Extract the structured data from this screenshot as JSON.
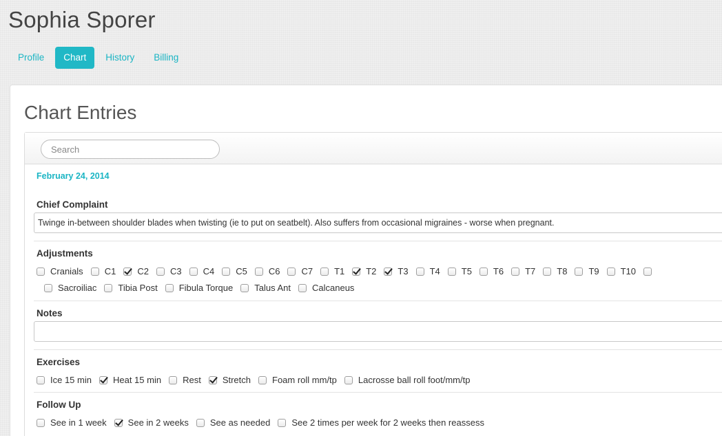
{
  "patient_name": "Sophia Sporer",
  "nav": [
    {
      "label": "Profile",
      "active": false
    },
    {
      "label": "Chart",
      "active": true
    },
    {
      "label": "History",
      "active": false
    },
    {
      "label": "Billing",
      "active": false
    }
  ],
  "panel": {
    "title": "Chart Entries",
    "search_placeholder": "Search"
  },
  "entry": {
    "date": "February 24, 2014",
    "chief_complaint": {
      "title": "Chief Complaint",
      "text": "Twinge in-between shoulder blades when twisting (ie to put on seatbelt). Also suffers from occasional migraines - worse when pregnant."
    },
    "adjustments": {
      "title": "Adjustments",
      "rows": [
        [
          {
            "label": "Cranials",
            "checked": false
          },
          {
            "label": "C1",
            "checked": false
          },
          {
            "label": "C2",
            "checked": true
          },
          {
            "label": "C3",
            "checked": false
          },
          {
            "label": "C4",
            "checked": false
          },
          {
            "label": "C5",
            "checked": false
          },
          {
            "label": "C6",
            "checked": false
          },
          {
            "label": "C7",
            "checked": false
          },
          {
            "label": "T1",
            "checked": false
          },
          {
            "label": "T2",
            "checked": true
          },
          {
            "label": "T3",
            "checked": true
          },
          {
            "label": "T4",
            "checked": false
          },
          {
            "label": "T5",
            "checked": false
          },
          {
            "label": "T6",
            "checked": false
          },
          {
            "label": "T7",
            "checked": false
          },
          {
            "label": "T8",
            "checked": false
          },
          {
            "label": "T9",
            "checked": false
          },
          {
            "label": "T10",
            "checked": false
          },
          {
            "label": "",
            "checked": false
          }
        ],
        [
          {
            "label": "Sacroiliac",
            "checked": false
          },
          {
            "label": "Tibia Post",
            "checked": false
          },
          {
            "label": "Fibula Torque",
            "checked": false
          },
          {
            "label": "Talus Ant",
            "checked": false
          },
          {
            "label": "Calcaneus",
            "checked": false
          }
        ]
      ]
    },
    "notes": {
      "title": "Notes",
      "value": ""
    },
    "exercises": {
      "title": "Exercises",
      "items": [
        {
          "label": "Ice 15 min",
          "checked": false
        },
        {
          "label": "Heat 15 min",
          "checked": true
        },
        {
          "label": "Rest",
          "checked": false
        },
        {
          "label": "Stretch",
          "checked": true
        },
        {
          "label": "Foam roll mm/tp",
          "checked": false
        },
        {
          "label": "Lacrosse ball roll foot/mm/tp",
          "checked": false
        }
      ]
    },
    "follow_up": {
      "title": "Follow Up",
      "items": [
        {
          "label": "See in 1 week",
          "checked": false
        },
        {
          "label": "See in 2 weeks",
          "checked": true
        },
        {
          "label": "See as needed",
          "checked": false
        },
        {
          "label": "See 2 times per week for 2 weeks then reassess",
          "checked": false
        }
      ]
    }
  },
  "colors": {
    "accent": "#20b8c6",
    "link": "#1ab5c4"
  }
}
